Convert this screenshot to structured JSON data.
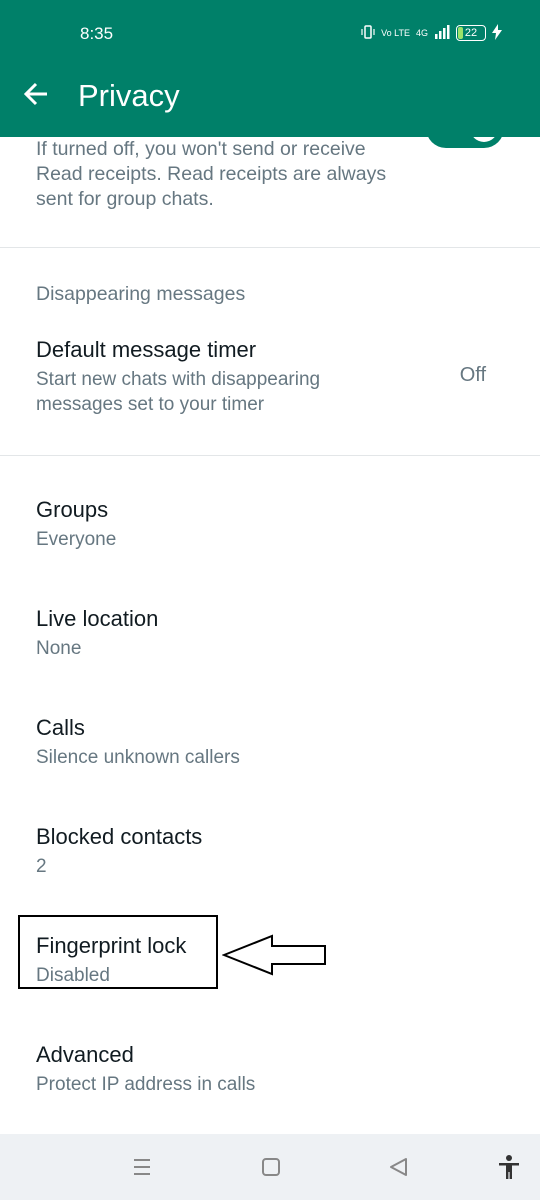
{
  "status_bar": {
    "time": "8:35",
    "network": "4G",
    "volte": "Vo LTE",
    "battery": "22"
  },
  "header": {
    "title": "Privacy",
    "back_icon": "arrow-left-icon"
  },
  "read_receipts": {
    "description": "If turned off, you won't send or receive Read receipts. Read receipts are always sent for group chats."
  },
  "disappearing": {
    "section_title": "Disappearing messages",
    "timer_title": "Default message timer",
    "timer_sub": "Start new chats with disappearing messages set to your timer",
    "timer_value": "Off"
  },
  "items": [
    {
      "title": "Groups",
      "sub": "Everyone"
    },
    {
      "title": "Live location",
      "sub": "None"
    },
    {
      "title": "Calls",
      "sub": "Silence unknown callers"
    },
    {
      "title": "Blocked contacts",
      "sub": "2"
    },
    {
      "title": "Fingerprint lock",
      "sub": "Disabled"
    },
    {
      "title": "Advanced",
      "sub": "Protect IP address in calls"
    }
  ],
  "colors": {
    "header": "#008069",
    "navbar": "#eef1f4",
    "secondary_text": "#667781"
  },
  "nav": [
    "menu-icon",
    "home-icon",
    "back-triangle-icon",
    "accessibility-icon"
  ]
}
